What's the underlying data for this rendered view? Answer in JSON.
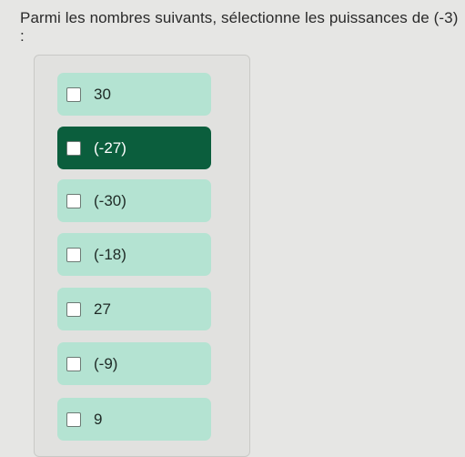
{
  "question": "Parmi les nombres suivants, sélectionne les puissances de (-3) :",
  "options": [
    {
      "label": "30",
      "selected": false
    },
    {
      "label": "(-27)",
      "selected": true
    },
    {
      "label": "(-30)",
      "selected": false
    },
    {
      "label": "(-18)",
      "selected": false
    },
    {
      "label": "27",
      "selected": false
    },
    {
      "label": "(-9)",
      "selected": false
    },
    {
      "label": "9",
      "selected": false
    }
  ],
  "colors": {
    "option_bg": "#b4e3d2",
    "option_selected_bg": "#0b5e3d",
    "page_bg": "#e6e6e4"
  }
}
